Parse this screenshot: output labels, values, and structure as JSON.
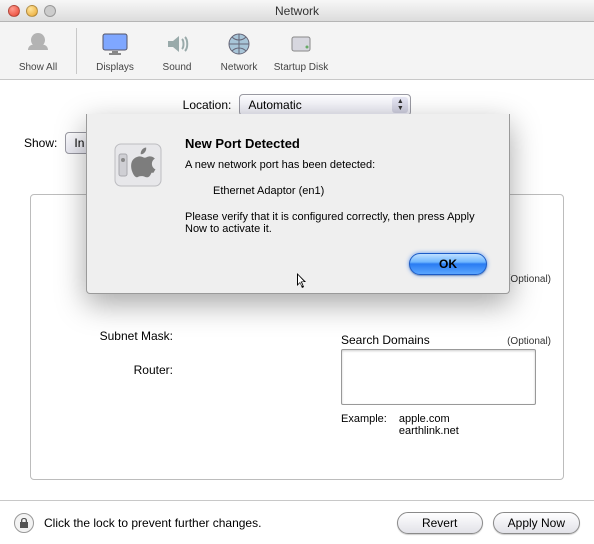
{
  "window": {
    "title": "Network"
  },
  "toolbar": {
    "show_all": "Show All",
    "displays": "Displays",
    "sound": "Sound",
    "network": "Network",
    "startup_disk": "Startup Disk"
  },
  "location": {
    "label": "Location:",
    "value": "Automatic"
  },
  "show": {
    "label": "Show:",
    "value_partial": "In"
  },
  "fields": {
    "subnet_mask": "Subnet Mask:",
    "router": "Router:"
  },
  "right": {
    "optional": "(Optional)",
    "search_domains": "Search Domains",
    "example_label": "Example:",
    "example_domain1": "apple.com",
    "example_domain2": "earthlink.net"
  },
  "lock_text": "Click the lock to prevent further changes.",
  "buttons": {
    "revert": "Revert",
    "apply_now": "Apply Now"
  },
  "modal": {
    "title": "New Port Detected",
    "line1": "A new network port has been detected:",
    "device": "Ethernet Adaptor (en1)",
    "line2": "Please verify that it is configured correctly, then press Apply Now to activate it.",
    "ok": "OK"
  }
}
